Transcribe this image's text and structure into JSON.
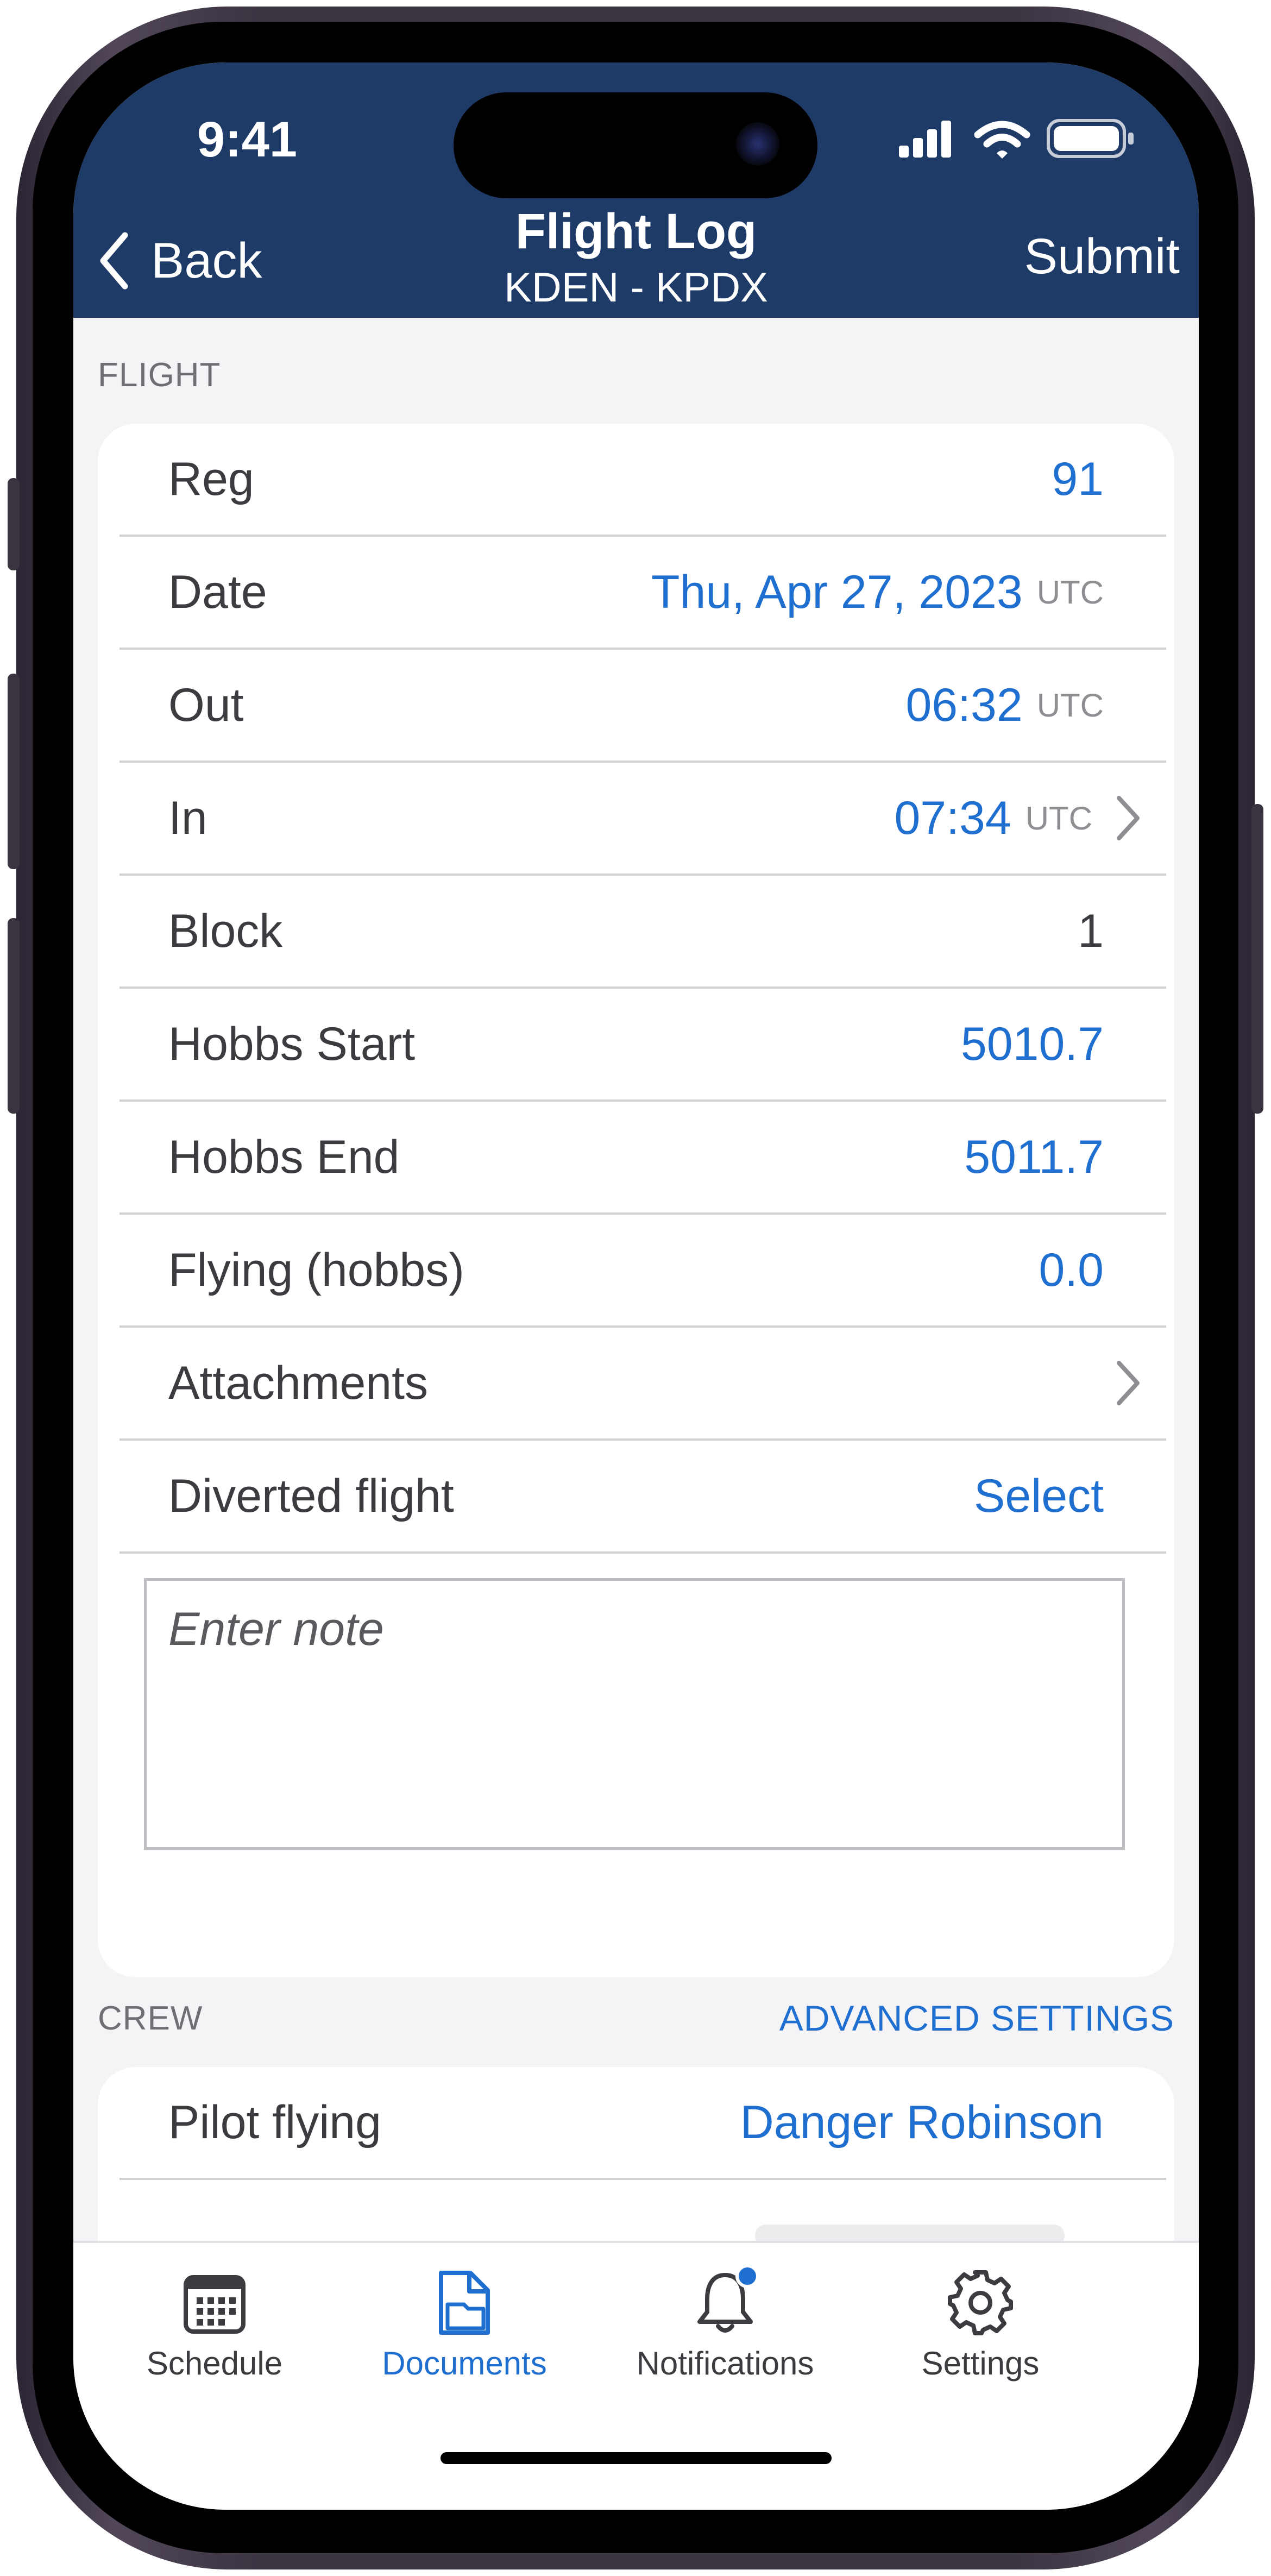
{
  "status_bar": {
    "time": "9:41"
  },
  "nav": {
    "back_label": "Back",
    "title": "Flight Log",
    "subtitle": "KDEN - KPDX",
    "submit_label": "Submit"
  },
  "flight_section": {
    "header": "FLIGHT",
    "rows": [
      {
        "label": "Reg",
        "value": "91"
      },
      {
        "label": "Date",
        "value": "Thu, Apr 27, 2023",
        "unit": "UTC"
      },
      {
        "label": "Out",
        "value": "06:32",
        "unit": "UTC"
      },
      {
        "label": "In",
        "value": "07:34",
        "unit": "UTC"
      },
      {
        "label": "Block",
        "value": "1"
      },
      {
        "label": "Hobbs Start",
        "value": "5010.7"
      },
      {
        "label": "Hobbs End",
        "value": "5011.7"
      },
      {
        "label": "Flying (hobbs)",
        "value": "0.0"
      },
      {
        "label": "Attachments"
      },
      {
        "label": "Diverted flight",
        "value": "Select"
      }
    ],
    "note_placeholder": "Enter note"
  },
  "crew_section": {
    "header": "CREW",
    "action": "ADVANCED SETTINGS",
    "rows": [
      {
        "label": "Pilot flying",
        "value": "Danger Robinson"
      }
    ]
  },
  "tab_bar": {
    "tabs": [
      {
        "label": "Schedule",
        "icon": "calendar-icon"
      },
      {
        "label": "Documents",
        "icon": "documents-icon",
        "active": true
      },
      {
        "label": "Notifications",
        "icon": "bell-icon",
        "badge": true
      },
      {
        "label": "Settings",
        "icon": "gear-icon"
      }
    ]
  },
  "colors": {
    "header_bg": "#1e3a66",
    "accent": "#1f6fd1",
    "screen_bg": "#f4f4f7",
    "badge": "#1f6fd1"
  }
}
